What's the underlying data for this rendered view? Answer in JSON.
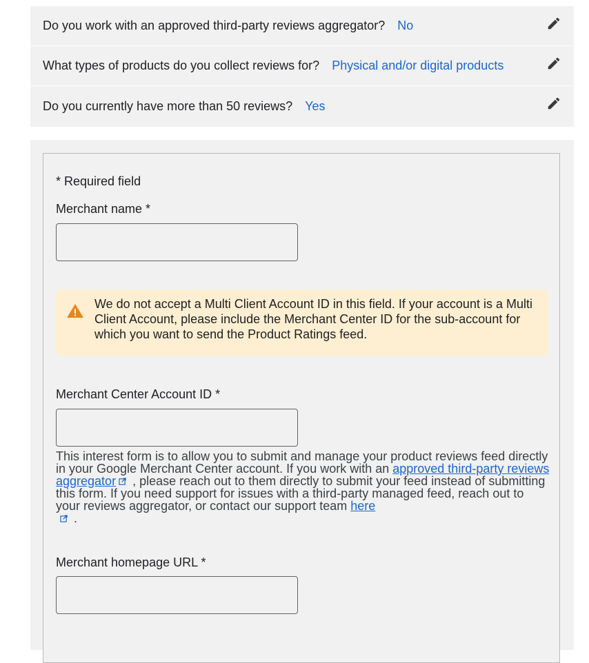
{
  "summary": {
    "rows": [
      {
        "question": "Do you work with an approved third-party reviews aggregator?",
        "answer": "No",
        "icon": "edit-pencil-icon"
      },
      {
        "question": "What types of products do you collect reviews for?",
        "answer": "Physical and/or digital products",
        "icon": "edit-pencil-icon"
      },
      {
        "question": "Do you currently have more than 50 reviews?",
        "answer": "Yes",
        "icon": "edit-pencil-icon"
      }
    ]
  },
  "form": {
    "required_note": "* Required field",
    "merchant_name": {
      "label": "Merchant name  *",
      "value": "",
      "placeholder": ""
    },
    "warning": {
      "icon": "warning-triangle-icon",
      "text": "We do not accept a Multi Client Account ID in this field. If your account is a Multi Client Account, please include the Merchant Center ID for the sub-account for which you want to send the Product Ratings feed."
    },
    "merchant_center_id": {
      "label": "Merchant Center Account ID *",
      "value": "",
      "placeholder": ""
    },
    "help": {
      "part1": "This interest form is to allow you to submit and manage your product reviews feed directly in your Google Merchant Center account.  If you work with an ",
      "link1": "approved third-party reviews aggregator",
      "part2": " , please reach out to them directly to submit your feed instead of submitting this form. If you need support for issues with a third-party managed feed, reach out to your reviews aggregator, or contact our support team ",
      "link2": "here",
      "part3": " ."
    },
    "homepage_url": {
      "label": "Merchant homepage URL  *",
      "value": "",
      "placeholder": ""
    }
  },
  "colors": {
    "accent": "#1a66d6",
    "panel_bg": "#f1f1f1",
    "warning_bg": "#feefd2",
    "warning_icon": "#e8861b"
  }
}
